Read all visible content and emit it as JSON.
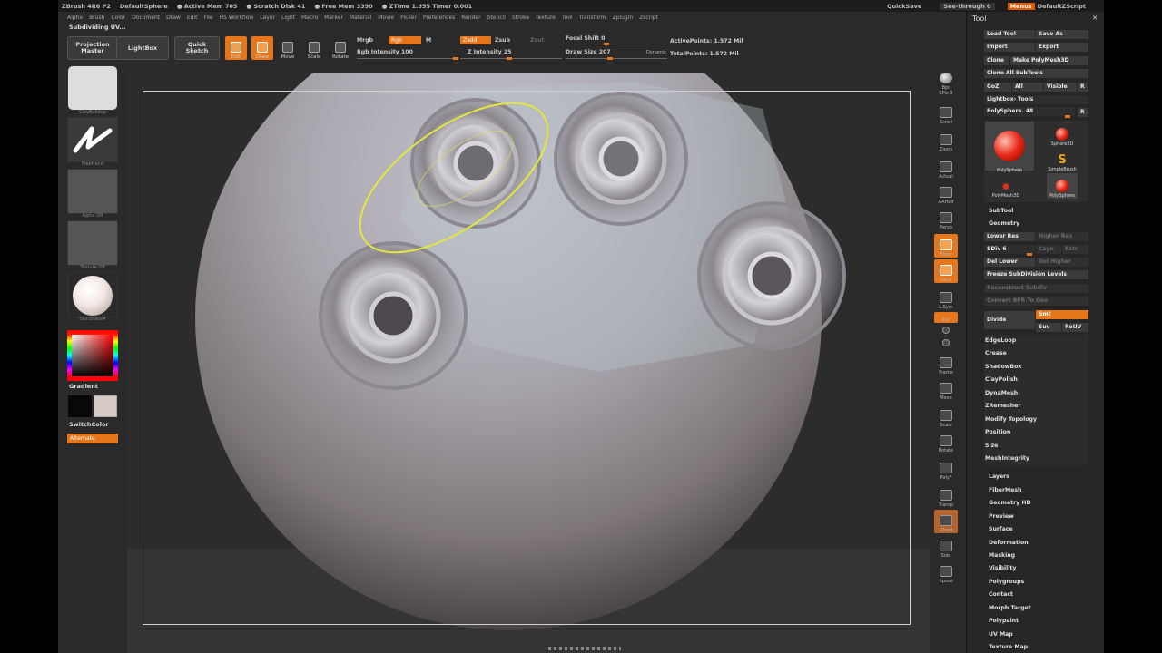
{
  "titlebar": {
    "app": "ZBrush 4R6 P2",
    "doc": "DefaultSphere",
    "active_mem": "● Active Mem 705",
    "scratch": "● Scratch Disk 41",
    "free_mem": "● Free Mem 3390",
    "ztime": "● ZTime 1.855 Timer 0.001",
    "quicksave": "QuickSave",
    "seethrough": "See-through  0",
    "menus": "Menus",
    "zscript": "DefaultZScript"
  },
  "menu": [
    "Alpha",
    "Brush",
    "Color",
    "Document",
    "Draw",
    "Edit",
    "File",
    "HS Workflow",
    "Layer",
    "Light",
    "Macro",
    "Marker",
    "Material",
    "Movie",
    "Picker",
    "Preferences",
    "Render",
    "Stencil",
    "Stroke",
    "Texture",
    "Tool",
    "Transform",
    "Zplugin",
    "Zscript"
  ],
  "status": "Subdividing UV...",
  "shelf": {
    "projection_master": "Projection\nMaster",
    "lightbox": "LightBox",
    "quick_sketch": "Quick\nSketch",
    "edit": "Edit",
    "draw": "Draw",
    "move": "Move",
    "scale": "Scale",
    "rotate": "Rotate",
    "mrgb": "Mrgb",
    "rgb": "Rgb",
    "m": "M",
    "zadd": "Zadd",
    "zsub": "Zsub",
    "zcut": "Zcut",
    "rgb_intensity": "Rgb Intensity 100",
    "z_intensity": "Z Intensity 25",
    "focal_shift": "Focal Shift 0",
    "draw_size": "Draw Size 207",
    "dynamic": "Dynamic",
    "active_points": "ActivePoints: 1.572 Mil",
    "total_points": "TotalPoints: 1.572 Mil"
  },
  "left_tray": {
    "brush_label": "ClayBuildup",
    "stroke_label": "FreeHand",
    "alpha_label": "Alpha Off",
    "texture_label": "Texture Off",
    "material_label": "SkinShade4",
    "gradient": "Gradient",
    "switchcolor": "SwitchColor",
    "alternate": "Alternate"
  },
  "right_icons": [
    "Bpr",
    "SPix 3",
    "Scroll",
    "Zoom",
    "Actual",
    "AAHalf",
    "Persp",
    "Floor",
    "Local",
    "L.Sym",
    "Xyz",
    "",
    "",
    "Frame",
    "Move",
    "Scale",
    "Rotate",
    "PolyF",
    "Transp",
    "Ghost",
    "Solo",
    "Xpose"
  ],
  "panel": {
    "title": "Tool",
    "load_tool": "Load Tool",
    "save_as": "Save As",
    "import": "Import",
    "export": "Export",
    "clone": "Clone",
    "make_polymesh": "Make PolyMesh3D",
    "clone_all": "Clone All SubTools",
    "goz": "GoZ",
    "all": "All",
    "visible": "Visible",
    "r": "R",
    "lightbox_tools": "Lightbox› Tools",
    "polysphere_slider": "PolySphere. 48",
    "tools": [
      "PolySphere",
      "Sphere3D",
      "SimpleBrush",
      "PolyMesh3D",
      "PolySphere"
    ],
    "subtool": "SubTool",
    "geometry": "Geometry",
    "lower_res": "Lower Res",
    "higher_res": "Higher Res",
    "sdiv": "SDiv 6",
    "cage": "Cage",
    "rstr": "Rstr",
    "del_lower": "Del Lower",
    "del_higher": "Del Higher",
    "freeze": "Freeze SubDivision Levels",
    "reconstruct": "Reconstruct Subdiv",
    "convert_bpr": "Convert BPR To Geo",
    "divide": "Divide",
    "smt": "Smt",
    "suv": "Suv",
    "reuv": "ReUV",
    "geometry_items": [
      "EdgeLoop",
      "Crease",
      "ShadowBox",
      "ClayPolish",
      "DynaMesh",
      "ZRemesher",
      "Modify Topology",
      "Position",
      "Size",
      "MeshIntegrity"
    ],
    "sections": [
      "Layers",
      "FiberMesh",
      "Geometry HD",
      "Preview",
      "Surface",
      "Deformation",
      "Masking",
      "Visibility",
      "Polygroups",
      "Contact",
      "Morph Target",
      "Polypaint",
      "UV Map",
      "Texture Map"
    ]
  },
  "colors": {
    "accent": "#e5761b",
    "background": "#2a2a2a",
    "panel": "#262626",
    "sphere": "#a7a3ab",
    "brush_ring": "#e4e63c"
  }
}
